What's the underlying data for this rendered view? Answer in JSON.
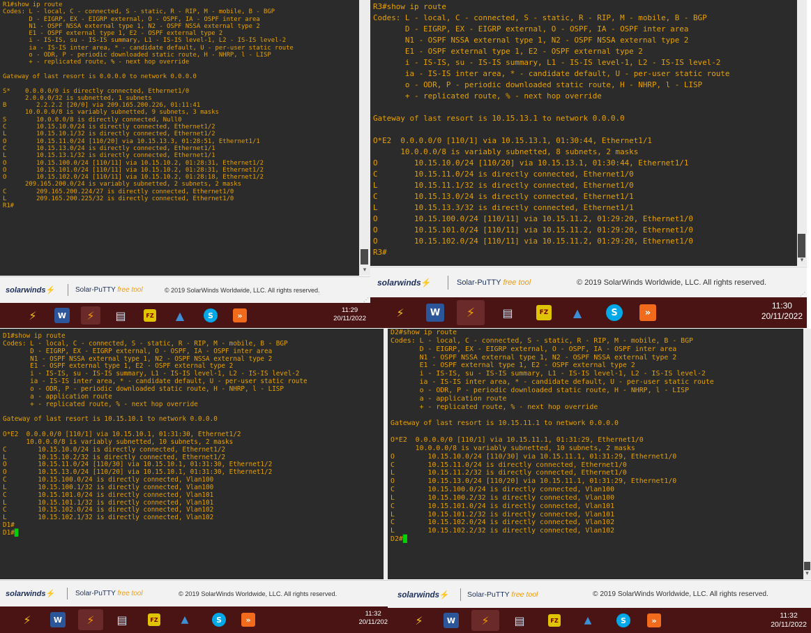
{
  "app": {
    "product_label": "Solar-PuTTY",
    "free_label": "free tool",
    "copyright": "© 2019 SolarWinds Worldwide, LLC. All rights reserved.",
    "brand": "solarwinds"
  },
  "colors": {
    "terminal_bg": "#2b2b2b",
    "terminal_text": "#e6a100",
    "cursor": "#00d000",
    "taskbar_bg": "#4a1414",
    "brand_orange": "#f49b00"
  },
  "taskbar_icons": [
    "putty-icon",
    "word-icon",
    "solar-putty-icon",
    "file-manager-icon",
    "filezilla-icon",
    "network-icon",
    "skype-icon",
    "app-icon"
  ],
  "windows": [
    {
      "id": "r1",
      "time": "11:29",
      "date": "20/11/2022",
      "lines": [
        "R1#show ip route",
        "Codes: L - local, C - connected, S - static, R - RIP, M - mobile, B - BGP",
        "       D - EIGRP, EX - EIGRP external, O - OSPF, IA - OSPF inter area",
        "       N1 - OSPF NSSA external type 1, N2 - OSPF NSSA external type 2",
        "       E1 - OSPF external type 1, E2 - OSPF external type 2",
        "       i - IS-IS, su - IS-IS summary, L1 - IS-IS level-1, L2 - IS-IS level-2",
        "       ia - IS-IS inter area, * - candidate default, U - per-user static route",
        "       o - ODR, P - periodic downloaded static route, H - NHRP, l - LISP",
        "       + - replicated route, % - next hop override",
        "",
        "Gateway of last resort is 0.0.0.0 to network 0.0.0.0",
        "",
        "S*    0.0.0.0/0 is directly connected, Ethernet1/0",
        "      2.0.0.0/32 is subnetted, 1 subnets",
        "B        2.2.2.2 [20/0] via 209.165.200.226, 01:11:41",
        "      10.0.0.0/8 is variably subnetted, 9 subnets, 3 masks",
        "S        10.0.0.0/8 is directly connected, Null0",
        "C        10.15.10.0/24 is directly connected, Ethernet1/2",
        "L        10.15.10.1/32 is directly connected, Ethernet1/2",
        "O        10.15.11.0/24 [110/20] via 10.15.13.3, 01:28:51, Ethernet1/1",
        "C        10.15.13.0/24 is directly connected, Ethernet1/1",
        "L        10.15.13.1/32 is directly connected, Ethernet1/1",
        "O        10.15.100.0/24 [110/11] via 10.15.10.2, 01:28:31, Ethernet1/2",
        "O        10.15.101.0/24 [110/11] via 10.15.10.2, 01:28:31, Ethernet1/2",
        "O        10.15.102.0/24 [110/11] via 10.15.10.2, 01:28:18, Ethernet1/2",
        "      209.165.200.0/24 is variably subnetted, 2 subnets, 2 masks",
        "C        209.165.200.224/27 is directly connected, Ethernet1/0",
        "L        209.165.200.225/32 is directly connected, Ethernet1/0",
        "R1#"
      ],
      "cursor": ""
    },
    {
      "id": "r3",
      "time": "11:30",
      "date": "20/11/2022",
      "lines": [
        "R3#show ip route",
        "Codes: L - local, C - connected, S - static, R - RIP, M - mobile, B - BGP",
        "       D - EIGRP, EX - EIGRP external, O - OSPF, IA - OSPF inter area",
        "       N1 - OSPF NSSA external type 1, N2 - OSPF NSSA external type 2",
        "       E1 - OSPF external type 1, E2 - OSPF external type 2",
        "       i - IS-IS, su - IS-IS summary, L1 - IS-IS level-1, L2 - IS-IS level-2",
        "       ia - IS-IS inter area, * - candidate default, U - per-user static route",
        "       o - ODR, P - periodic downloaded static route, H - NHRP, l - LISP",
        "       + - replicated route, % - next hop override",
        "",
        "Gateway of last resort is 10.15.13.1 to network 0.0.0.0",
        "",
        "O*E2  0.0.0.0/0 [110/1] via 10.15.13.1, 01:30:44, Ethernet1/1",
        "      10.0.0.0/8 is variably subnetted, 8 subnets, 2 masks",
        "O        10.15.10.0/24 [110/20] via 10.15.13.1, 01:30:44, Ethernet1/1",
        "C        10.15.11.0/24 is directly connected, Ethernet1/0",
        "L        10.15.11.1/32 is directly connected, Ethernet1/0",
        "C        10.15.13.0/24 is directly connected, Ethernet1/1",
        "L        10.15.13.3/32 is directly connected, Ethernet1/1",
        "O        10.15.100.0/24 [110/11] via 10.15.11.2, 01:29:20, Ethernet1/0",
        "O        10.15.101.0/24 [110/11] via 10.15.11.2, 01:29:20, Ethernet1/0",
        "O        10.15.102.0/24 [110/11] via 10.15.11.2, 01:29:20, Ethernet1/0",
        "R3#"
      ],
      "cursor": ""
    },
    {
      "id": "d1",
      "time": "11:32",
      "date": "20/11/202",
      "lines": [
        "D1#show ip route",
        "Codes: L - local, C - connected, S - static, R - RIP, M - mobile, B - BGP",
        "       D - EIGRP, EX - EIGRP external, O - OSPF, IA - OSPF inter area",
        "       N1 - OSPF NSSA external type 1, N2 - OSPF NSSA external type 2",
        "       E1 - OSPF external type 1, E2 - OSPF external type 2",
        "       i - IS-IS, su - IS-IS summary, L1 - IS-IS level-1, L2 - IS-IS level-2",
        "       ia - IS-IS inter area, * - candidate default, U - per-user static route",
        "       o - ODR, P - periodic downloaded static route, H - NHRP, l - LISP",
        "       a - application route",
        "       + - replicated route, % - next hop override",
        "",
        "Gateway of last resort is 10.15.10.1 to network 0.0.0.0",
        "",
        "O*E2  0.0.0.0/0 [110/1] via 10.15.10.1, 01:31:30, Ethernet1/2",
        "      10.0.0.0/8 is variably subnetted, 10 subnets, 2 masks",
        "C        10.15.10.0/24 is directly connected, Ethernet1/2",
        "L        10.15.10.2/32 is directly connected, Ethernet1/2",
        "O        10.15.11.0/24 [110/30] via 10.15.10.1, 01:31:30, Ethernet1/2",
        "O        10.15.13.0/24 [110/20] via 10.15.10.1, 01:31:30, Ethernet1/2",
        "C        10.15.100.0/24 is directly connected, Vlan100",
        "L        10.15.100.1/32 is directly connected, Vlan100",
        "C        10.15.101.0/24 is directly connected, Vlan101",
        "L        10.15.101.1/32 is directly connected, Vlan101",
        "C        10.15.102.0/24 is directly connected, Vlan102",
        "L        10.15.102.1/32 is directly connected, Vlan102",
        "D1#"
      ],
      "cursor": "D1#"
    },
    {
      "id": "d2",
      "time": "11:32",
      "date": "20/11/2022",
      "lines": [
        "D2#show ip route",
        "Codes: L - local, C - connected, S - static, R - RIP, M - mobile, B - BGP",
        "       D - EIGRP, EX - EIGRP external, O - OSPF, IA - OSPF inter area",
        "       N1 - OSPF NSSA external type 1, N2 - OSPF NSSA external type 2",
        "       E1 - OSPF external type 1, E2 - OSPF external type 2",
        "       i - IS-IS, su - IS-IS summary, L1 - IS-IS level-1, L2 - IS-IS level-2",
        "       ia - IS-IS inter area, * - candidate default, U - per-user static route",
        "       o - ODR, P - periodic downloaded static route, H - NHRP, l - LISP",
        "       a - application route",
        "       + - replicated route, % - next hop override",
        "",
        "Gateway of last resort is 10.15.11.1 to network 0.0.0.0",
        "",
        "O*E2  0.0.0.0/0 [110/1] via 10.15.11.1, 01:31:29, Ethernet1/0",
        "      10.0.0.0/8 is variably subnetted, 10 subnets, 2 masks",
        "O        10.15.10.0/24 [110/30] via 10.15.11.1, 01:31:29, Ethernet1/0",
        "C        10.15.11.0/24 is directly connected, Ethernet1/0",
        "L        10.15.11.2/32 is directly connected, Ethernet1/0",
        "O        10.15.13.0/24 [110/20] via 10.15.11.1, 01:31:29, Ethernet1/0",
        "C        10.15.100.0/24 is directly connected, Vlan100",
        "L        10.15.100.2/32 is directly connected, Vlan100",
        "C        10.15.101.0/24 is directly connected, Vlan101",
        "L        10.15.101.2/32 is directly connected, Vlan101",
        "C        10.15.102.0/24 is directly connected, Vlan102",
        "L        10.15.102.2/32 is directly connected, Vlan102"
      ],
      "cursor": "D2#"
    }
  ]
}
